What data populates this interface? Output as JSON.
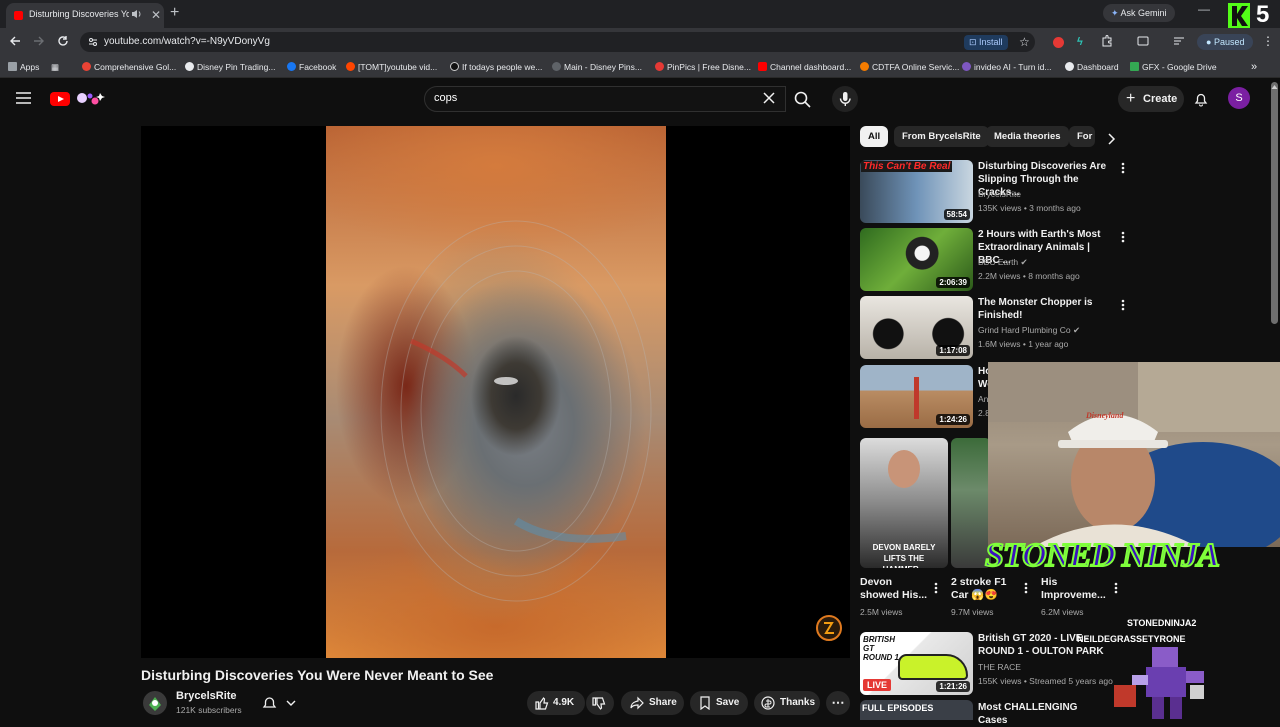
{
  "browser": {
    "tab_title": "Disturbing Discoveries You",
    "tab_close": "✕",
    "new_tab": "+",
    "ask_gemini": "Ask Gemini",
    "url": "youtube.com/watch?v=-N9yVDonyVg",
    "install_label": "Install",
    "profile_status": "Paused",
    "overlay_badge": "5",
    "bookmarks": [
      {
        "label": "Apps",
        "color": "#9aa0a6"
      },
      {
        "label": "Comprehensive Gol...",
        "color": "#ea4335"
      },
      {
        "label": "Disney Pin Trading...",
        "color": "#e8eaed"
      },
      {
        "label": "Facebook",
        "color": "#1877f2"
      },
      {
        "label": "[TOMT]youtube vid...",
        "color": "#ff4500"
      },
      {
        "label": "If todays people we...",
        "color": "#111111"
      },
      {
        "label": "Main - Disney Pins...",
        "color": "#5f6368"
      },
      {
        "label": "PinPics | Free Disne...",
        "color": "#e53935"
      },
      {
        "label": "Channel dashboard...",
        "color": "#ff0000"
      },
      {
        "label": "CDTFA Online Servic...",
        "color": "#f57c00"
      },
      {
        "label": "invideo AI - Turn id...",
        "color": "#7e57c2"
      },
      {
        "label": "Dashboard",
        "color": "#e8eaed"
      },
      {
        "label": "GFX - Google Drive",
        "color": "#34a853"
      }
    ]
  },
  "youtube": {
    "search_query": "cops",
    "create_label": "Create",
    "avatar_letter": "S",
    "video": {
      "title": "Disturbing Discoveries You Were Never Meant to See",
      "channel": "BrycelsRite",
      "subscribers": "121K subscribers",
      "likes": "4.9K",
      "share_label": "Share",
      "save_label": "Save",
      "thanks_label": "Thanks"
    },
    "chips": [
      "All",
      "From BrycelsRite",
      "Media theories",
      "For"
    ],
    "recommendations": [
      {
        "title": "Disturbing Discoveries Are Slipping Through the Cracks...",
        "channel": "BrycelsRite",
        "meta": "135K views • 3 months ago",
        "duration": "58:54",
        "thumb_text": "This Can't Be Real",
        "verified": false
      },
      {
        "title": "2 Hours with Earth's Most Extraordinary Animals | BBC ...",
        "channel": "BBC Earth",
        "meta": "2.2M views • 8 months ago",
        "duration": "2:06:39",
        "verified": true
      },
      {
        "title": "The Monster Chopper is Finished!",
        "channel": "Grind Hard Plumbing Co",
        "meta": "1.6M views • 1 year ago",
        "duration": "1:17:08",
        "verified": true
      },
      {
        "title": "Ho Wo",
        "channel": "Ani",
        "meta": "2.8",
        "duration": "1:24:26",
        "verified": false
      }
    ],
    "shorts": [
      {
        "title": "Devon showed His...",
        "views": "2.5M views",
        "thumb_text": "DEVON BARELY LIFTS THE HAMMER..."
      },
      {
        "title": "2 stroke F1 Car 😱😍",
        "views": "9.7M views"
      },
      {
        "title": "His Improveme...",
        "views": "6.2M views"
      }
    ],
    "more_recommendations": [
      {
        "title": "British GT 2020 - LIVE - ROUND 1 - OULTON PARK",
        "channel": "THE RACE",
        "meta": "155K views • Streamed 5 years ago",
        "duration": "1:21:26",
        "thumb_text": "BRITISH GT ROUND 1",
        "live_badge": "LIVE"
      },
      {
        "title": "Most CHALLENGING Cases",
        "thumb_text": "FULL EPISODES"
      }
    ]
  },
  "stream_overlay": {
    "banner": "STONED NINJA",
    "handle": "STONEDNINJA2",
    "ticker": "NEILDEGRASSETYRONE",
    "cap_text": "Disneyland"
  }
}
